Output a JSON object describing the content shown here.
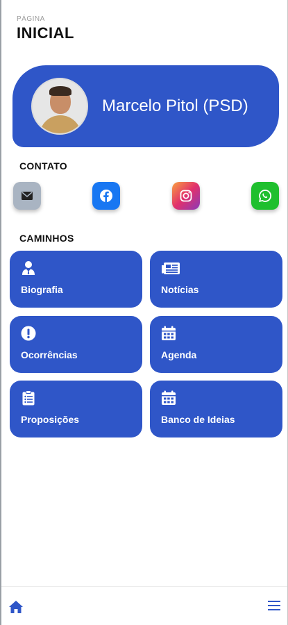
{
  "header": {
    "subtitle": "PÁGINA",
    "title": "INICIAL"
  },
  "profile": {
    "name": "Marcelo Pitol (PSD)"
  },
  "contact": {
    "title": "CONTATO",
    "items": [
      {
        "icon": "mail-icon",
        "color": "#a9b4c2"
      },
      {
        "icon": "facebook-icon",
        "color": "#1877f2"
      },
      {
        "icon": "instagram-icon",
        "color": "#e1306c"
      },
      {
        "icon": "whatsapp-icon",
        "color": "#25d366"
      }
    ]
  },
  "paths": {
    "title": "CAMINHOS",
    "items": [
      {
        "label": "Biografia",
        "icon": "user-tie-icon"
      },
      {
        "label": "Notícias",
        "icon": "newspaper-icon"
      },
      {
        "label": "Ocorrências",
        "icon": "alert-circle-icon"
      },
      {
        "label": "Agenda",
        "icon": "calendar-icon"
      },
      {
        "label": "Proposições",
        "icon": "clipboard-list-icon"
      },
      {
        "label": "Banco de Ideias",
        "icon": "calendar-icon"
      }
    ]
  },
  "colors": {
    "primary": "#2f56c8",
    "background": "#ffffff"
  },
  "nav": {
    "home_icon": "home-icon",
    "menu_icon": "hamburger-menu-icon"
  }
}
